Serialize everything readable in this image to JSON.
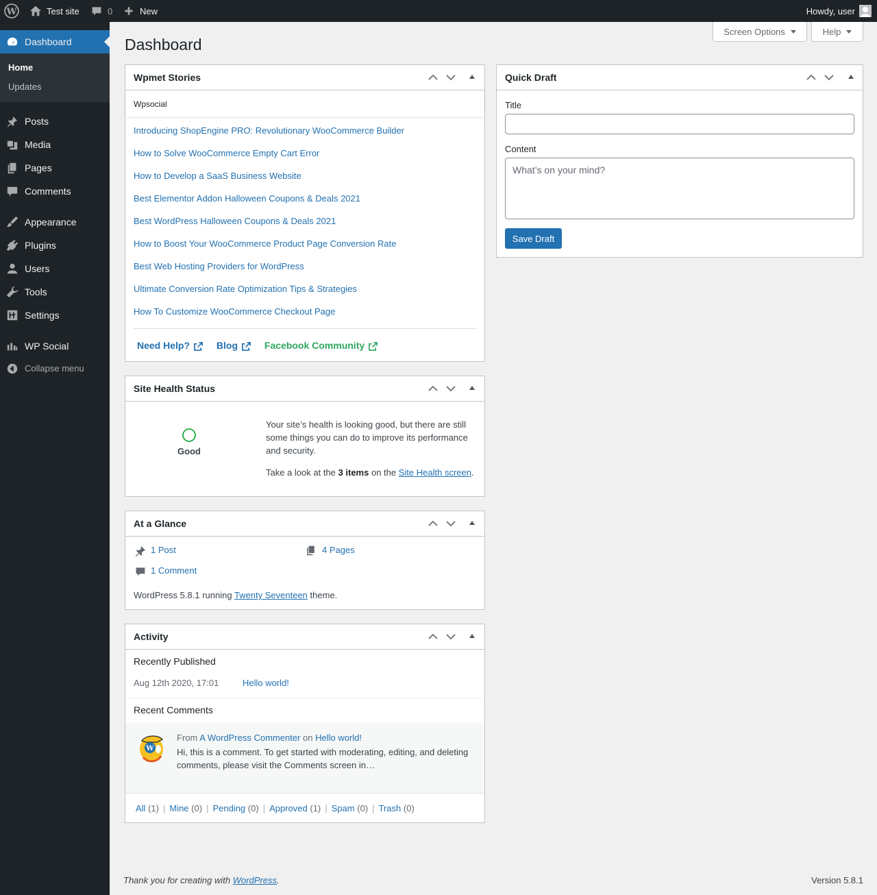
{
  "adminbar": {
    "site_name": "Test site",
    "comments_count": "0",
    "new_label": "New",
    "howdy": "Howdy, user"
  },
  "sidebar": {
    "dashboard": "Dashboard",
    "sub": [
      "Home",
      "Updates"
    ],
    "items": [
      "Posts",
      "Media",
      "Pages",
      "Comments",
      "Appearance",
      "Plugins",
      "Users",
      "Tools",
      "Settings",
      "WP Social"
    ],
    "collapse": "Collapse menu"
  },
  "screen_meta": {
    "screen_options": "Screen Options",
    "help": "Help"
  },
  "page_title": "Dashboard",
  "wpmet": {
    "title": "Wpmet Stories",
    "tab": "Wpsocial",
    "stories": [
      "Introducing ShopEngine PRO: Revolutionary WooCommerce Builder",
      "How to Solve WooCommerce Empty Cart Error",
      "How to Develop a SaaS Business Website",
      "Best Elementor Addon Halloween Coupons & Deals 2021",
      "Best WordPress Halloween Coupons & Deals 2021",
      "How to Boost Your WooCommerce Product Page Conversion Rate",
      "Best Web Hosting Providers for WordPress",
      "Ultimate Conversion Rate Optimization Tips & Strategies",
      "How To Customize WooCommerce Checkout Page"
    ],
    "footer": {
      "help": "Need Help?",
      "blog": "Blog",
      "community": "Facebook Community"
    }
  },
  "quick_draft": {
    "title": "Quick Draft",
    "title_label": "Title",
    "content_label": "Content",
    "content_placeholder": "What’s on your mind?",
    "save": "Save Draft"
  },
  "site_health": {
    "title": "Site Health Status",
    "status": "Good",
    "message": "Your site’s health is looking good, but there are still some things you can do to improve its performance and security.",
    "take_look": "Take a look at the",
    "items": "3 items",
    "on_the": "on the",
    "link": "Site Health screen",
    "end": "."
  },
  "glance": {
    "title": "At a Glance",
    "posts": "1 Post",
    "pages": "4 Pages",
    "comments": "1 Comment",
    "version_text": "WordPress 5.8.1 running",
    "theme": "Twenty Seventeen",
    "theme_suffix": "theme."
  },
  "activity": {
    "title": "Activity",
    "recently_published": "Recently Published",
    "post_date": "Aug 12th 2020, 17:01",
    "post_title": "Hello world!",
    "recent_comments": "Recent Comments",
    "comment_from": "From",
    "comment_author": "A WordPress Commenter",
    "comment_on": "on",
    "comment_post": "Hello world!",
    "comment_text": "Hi, this is a comment. To get started with moderating, editing, and deleting comments, please visit the Comments screen in…",
    "filters": [
      {
        "label": "All",
        "count": "(1)"
      },
      {
        "label": "Mine",
        "count": "(0)"
      },
      {
        "label": "Pending",
        "count": "(0)"
      },
      {
        "label": "Approved",
        "count": "(1)"
      },
      {
        "label": "Spam",
        "count": "(0)"
      },
      {
        "label": "Trash",
        "count": "(0)"
      }
    ]
  },
  "footer": {
    "thanks": "Thank you for creating with",
    "wp": "WordPress",
    "period": ".",
    "version": "Version 5.8.1"
  }
}
